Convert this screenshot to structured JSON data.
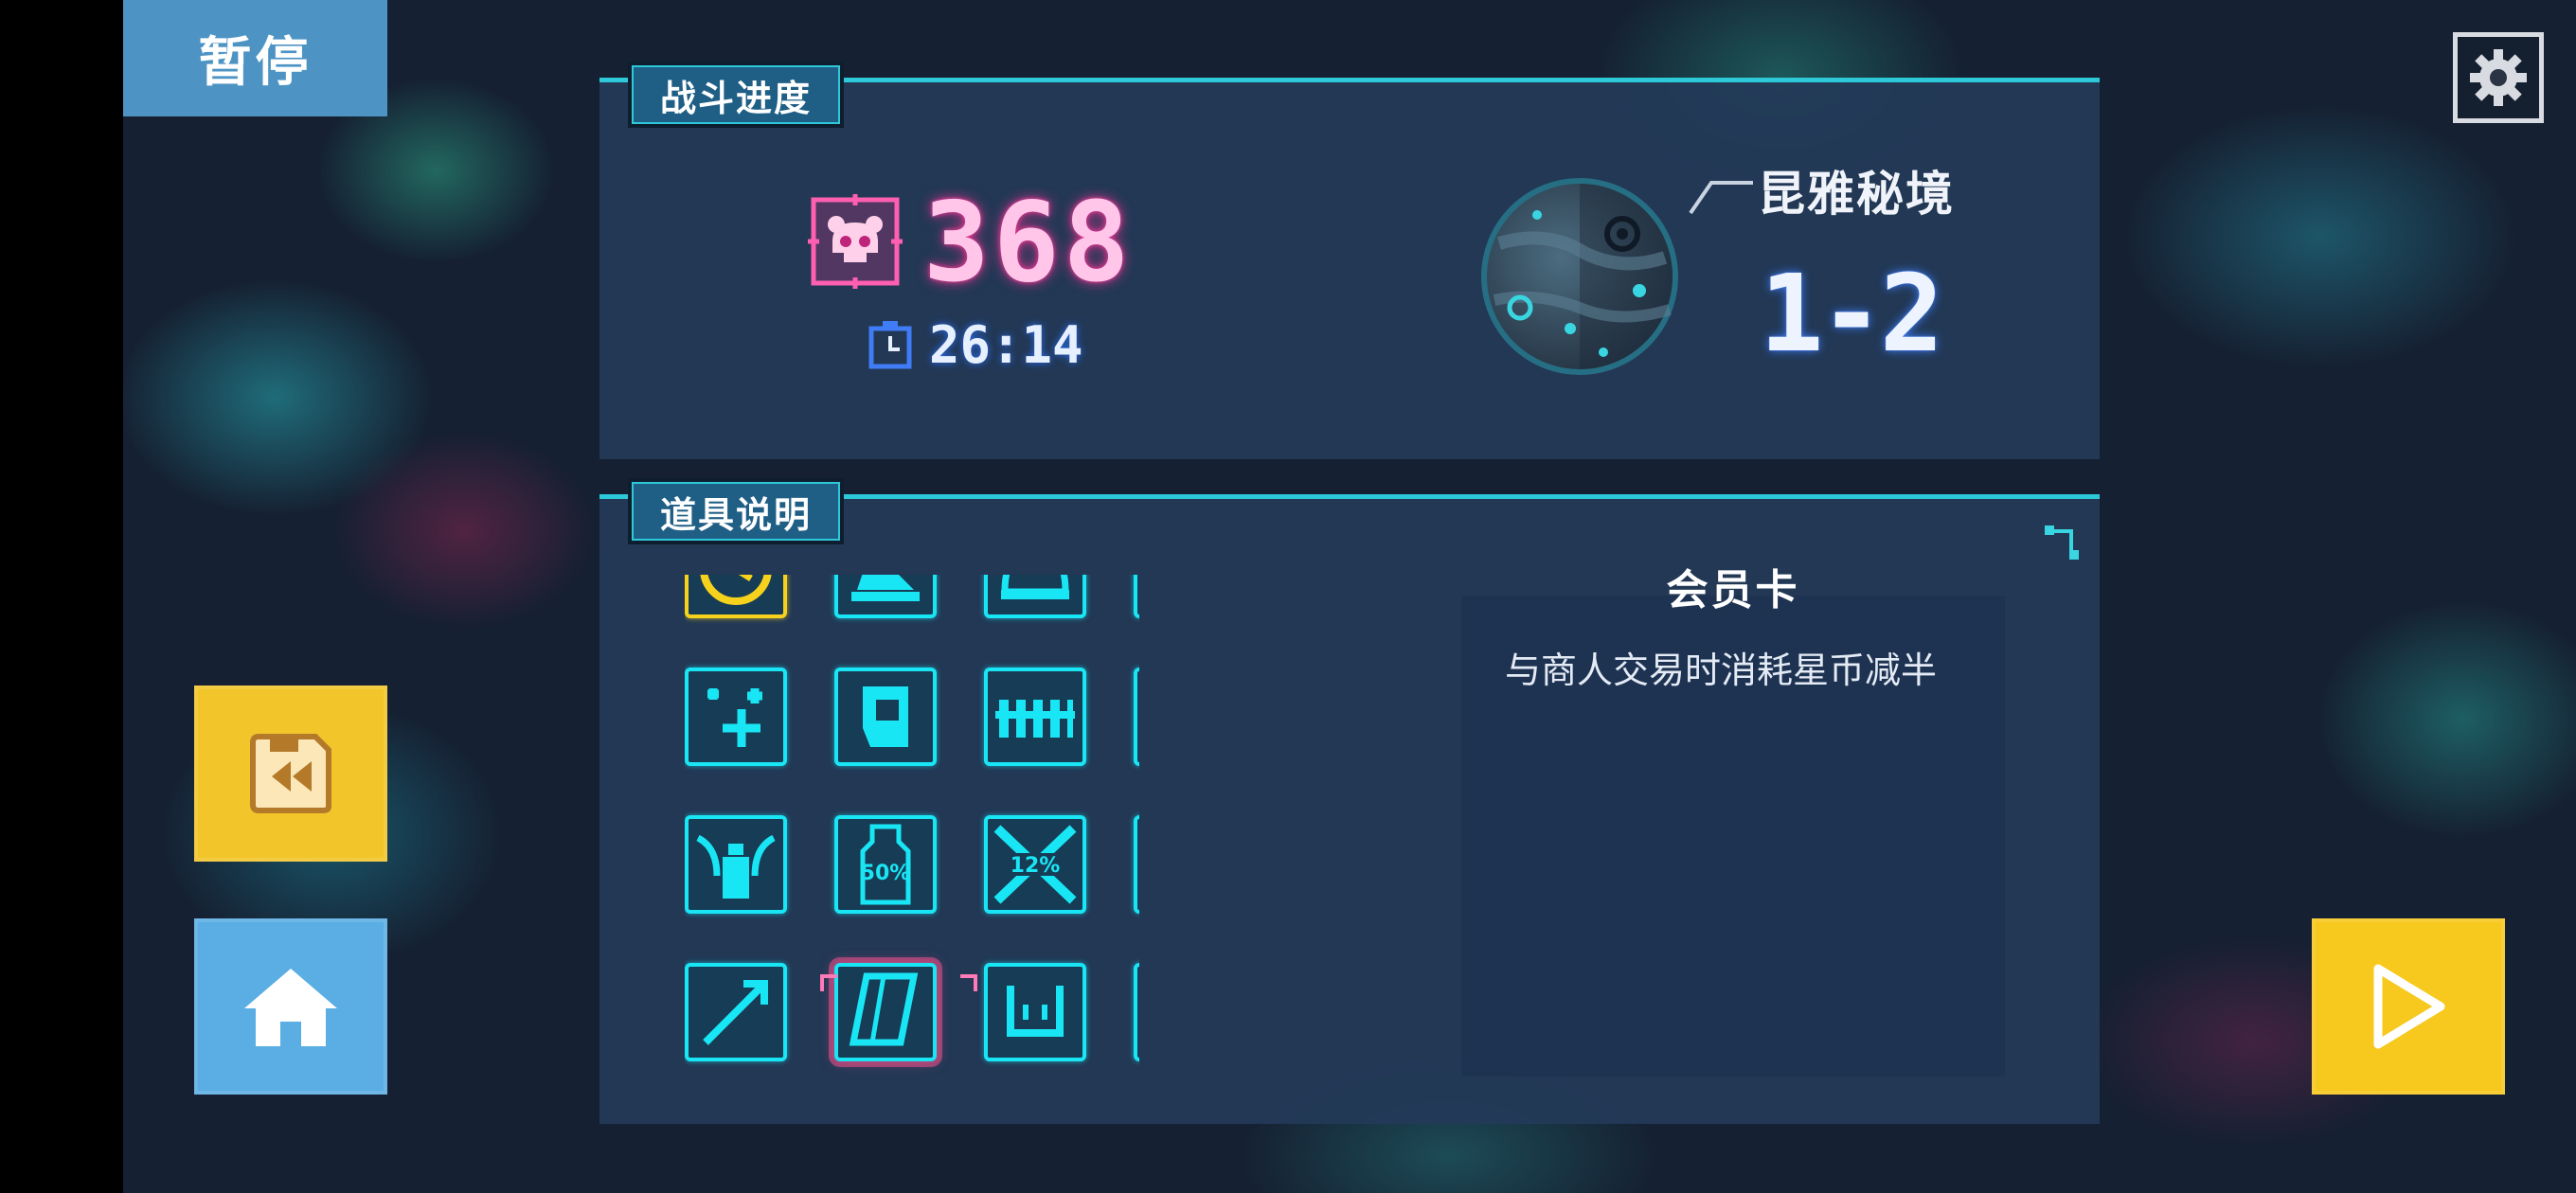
{
  "pause_label": "暂停",
  "progress": {
    "tab_label": "战斗进度",
    "kill_count": "368",
    "time": "26:14",
    "realm_name": "昆雅秘境",
    "stage": "1-2"
  },
  "items_panel": {
    "tab_label": "道具说明",
    "selected_item": {
      "name": "会员卡",
      "description": "与商人交易时消耗星币减半"
    },
    "grid_rows": [
      [
        "clock-icon",
        "altar-icon",
        "helmet-icon",
        "card-icon",
        "ball-icon"
      ],
      [
        "plus-cross-icon",
        "glove-icon",
        "fence-icon",
        "skull-target-icon",
        "boot-icon"
      ],
      [
        "potion-icon",
        "bottle-50-icon",
        "swords-12-icon",
        "coffin-icon",
        "cross-circle-icon"
      ],
      [
        "arrow-icon",
        "card-icon",
        "magnet-icon",
        "crossed-sword-icon",
        "wrench-icon"
      ]
    ],
    "grid_badges": {
      "bottle": "50%",
      "swords": "12%"
    }
  },
  "colors": {
    "neon_cyan": "#19e6f5",
    "neon_pink": "#e1338d",
    "gold": "#f6d21d",
    "panel": "#243a58"
  }
}
